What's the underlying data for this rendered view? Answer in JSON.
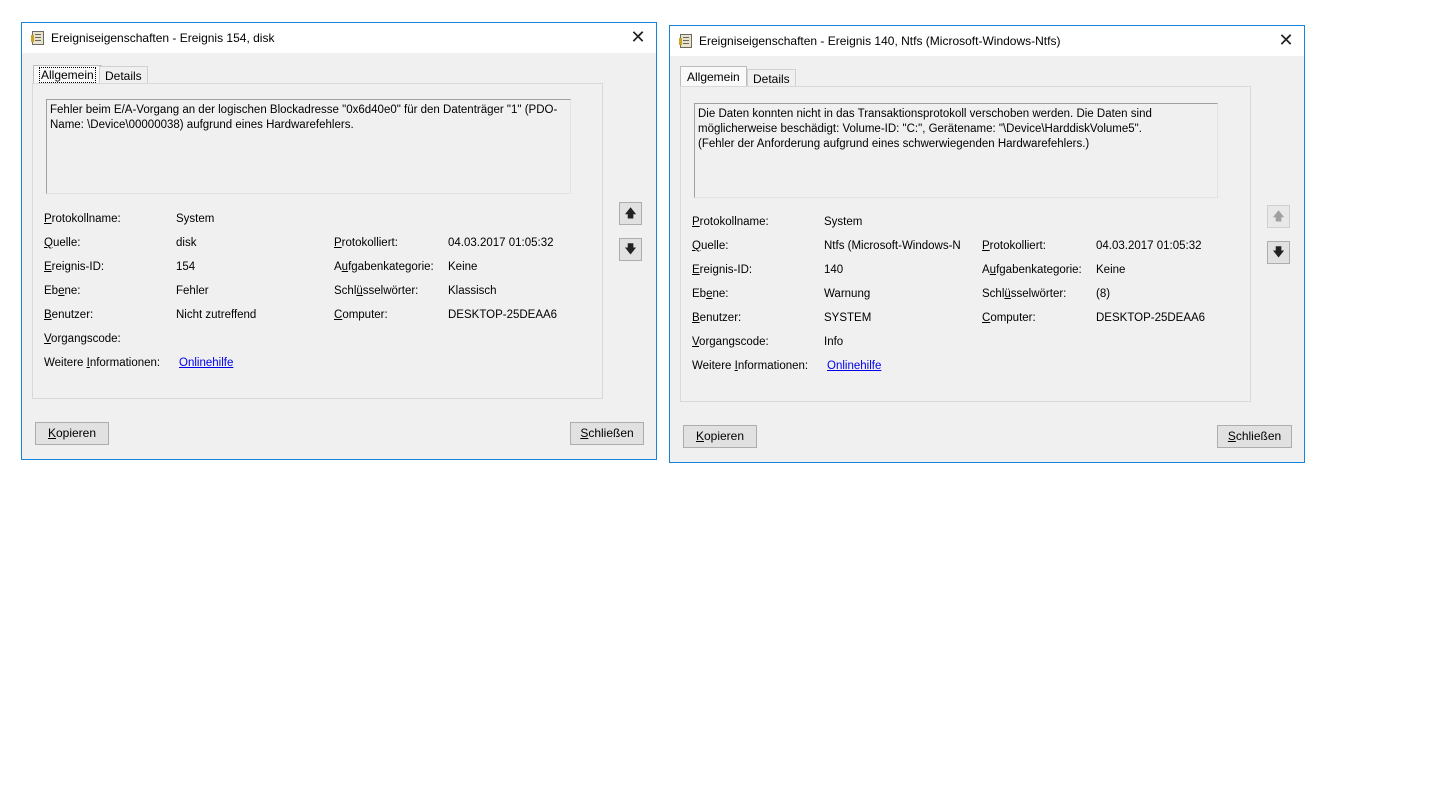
{
  "dialogs": [
    {
      "title": "Ereigniseigenschaften - Ereignis 154, disk",
      "tabs": [
        "Allgemein",
        "Details"
      ],
      "description": "Fehler beim E/A-Vorgang an der logischen Blockadresse \"0x6d40e0\" für den Datenträger \"1\" (PDO-\nName: \\Device\\00000038) aufgrund eines Hardwarefehlers.",
      "fields": {
        "protokollname": {
          "label": "Protokollname:",
          "value": "System"
        },
        "quelle": {
          "label": "Quelle:",
          "value": "disk"
        },
        "ereignis_id": {
          "label": "Ereignis-ID:",
          "value": "154"
        },
        "ebene": {
          "label": "Ebene:",
          "value": "Fehler"
        },
        "benutzer": {
          "label": "Benutzer:",
          "value": "Nicht zutreffend"
        },
        "vorgangscode": {
          "label": "Vorgangscode:",
          "value": ""
        },
        "weitere": {
          "label": "Weitere Informationen:",
          "value": "Onlinehilfe"
        },
        "protokolliert": {
          "label": "Protokolliert:",
          "value": "04.03.2017 01:05:32"
        },
        "aufgabenkategorie": {
          "label": "Aufgabenkategorie:",
          "value": "Keine"
        },
        "schluesselwoerter": {
          "label": "Schlüsselwörter:",
          "value": "Klassisch"
        },
        "computer": {
          "label": "Computer:",
          "value": "DESKTOP-25DEAA6"
        }
      },
      "buttons": {
        "copy": "Kopieren",
        "close": "Schließen"
      },
      "nav": {
        "up_enabled": true,
        "down_enabled": true
      }
    },
    {
      "title": "Ereigniseigenschaften - Ereignis 140, Ntfs (Microsoft-Windows-Ntfs)",
      "tabs": [
        "Allgemein",
        "Details"
      ],
      "description": "Die Daten konnten nicht in das Transaktionsprotokoll verschoben werden. Die Daten sind\nmöglicherweise beschädigt: Volume-ID: \"C:\", Gerätename: \"\\Device\\HarddiskVolume5\".\n(Fehler der Anforderung aufgrund eines schwerwiegenden Hardwarefehlers.)",
      "fields": {
        "protokollname": {
          "label": "Protokollname:",
          "value": "System"
        },
        "quelle": {
          "label": "Quelle:",
          "value": "Ntfs (Microsoft-Windows-N"
        },
        "ereignis_id": {
          "label": "Ereignis-ID:",
          "value": "140"
        },
        "ebene": {
          "label": "Ebene:",
          "value": "Warnung"
        },
        "benutzer": {
          "label": "Benutzer:",
          "value": "SYSTEM"
        },
        "vorgangscode": {
          "label": "Vorgangscode:",
          "value": "Info"
        },
        "weitere": {
          "label": "Weitere Informationen:",
          "value": "Onlinehilfe"
        },
        "protokolliert": {
          "label": "Protokolliert:",
          "value": "04.03.2017 01:05:32"
        },
        "aufgabenkategorie": {
          "label": "Aufgabenkategorie:",
          "value": "Keine"
        },
        "schluesselwoerter": {
          "label": "Schlüsselwörter:",
          "value": "(8)"
        },
        "computer": {
          "label": "Computer:",
          "value": "DESKTOP-25DEAA6"
        }
      },
      "buttons": {
        "copy": "Kopieren",
        "close": "Schließen"
      },
      "nav": {
        "up_enabled": false,
        "down_enabled": true
      }
    }
  ],
  "icons": {
    "close": "✕",
    "up": "🡅",
    "down": "🡇"
  }
}
